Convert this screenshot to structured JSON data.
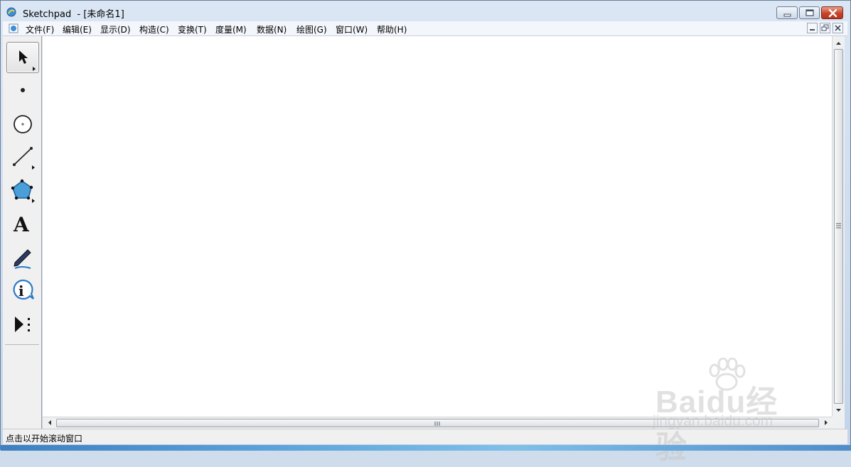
{
  "window": {
    "title": "Sketchpad  - [未命名1]"
  },
  "menu": {
    "items": [
      {
        "label": "文件(F)"
      },
      {
        "label": "编辑(E)"
      },
      {
        "label": "显示(D)"
      },
      {
        "label": "构造(C)"
      },
      {
        "label": "变换(T)"
      },
      {
        "label": "度量(M)"
      },
      {
        "label": "数据(N)"
      },
      {
        "label": "绘图(G)"
      },
      {
        "label": "窗口(W)"
      },
      {
        "label": "帮助(H)"
      }
    ]
  },
  "toolbox": {
    "tools": [
      {
        "name": "selection-arrow-tool",
        "icon": "arrow-icon",
        "active": true
      },
      {
        "name": "point-tool",
        "icon": "point-icon"
      },
      {
        "name": "compass-tool",
        "icon": "circle-icon"
      },
      {
        "name": "straightedge-tool",
        "icon": "segment-icon"
      },
      {
        "name": "polygon-tool",
        "icon": "polygon-icon"
      },
      {
        "name": "text-tool",
        "icon": "text-A-icon",
        "glyph": "A"
      },
      {
        "name": "marker-tool",
        "icon": "marker-icon"
      },
      {
        "name": "information-tool",
        "icon": "info-icon",
        "glyph": "i"
      },
      {
        "name": "custom-tool",
        "icon": "custom-tools-icon"
      }
    ]
  },
  "status": {
    "text": "点击以开始滚动窗口"
  },
  "watermark": {
    "brand": "Baidu经验",
    "url": "jingyan.baidu.com"
  },
  "colors": {
    "canvas": "#ffffff",
    "close_button": "#c8432a",
    "polygon_fill": "#4a9fd8",
    "info_blue": "#2b7ac6"
  }
}
